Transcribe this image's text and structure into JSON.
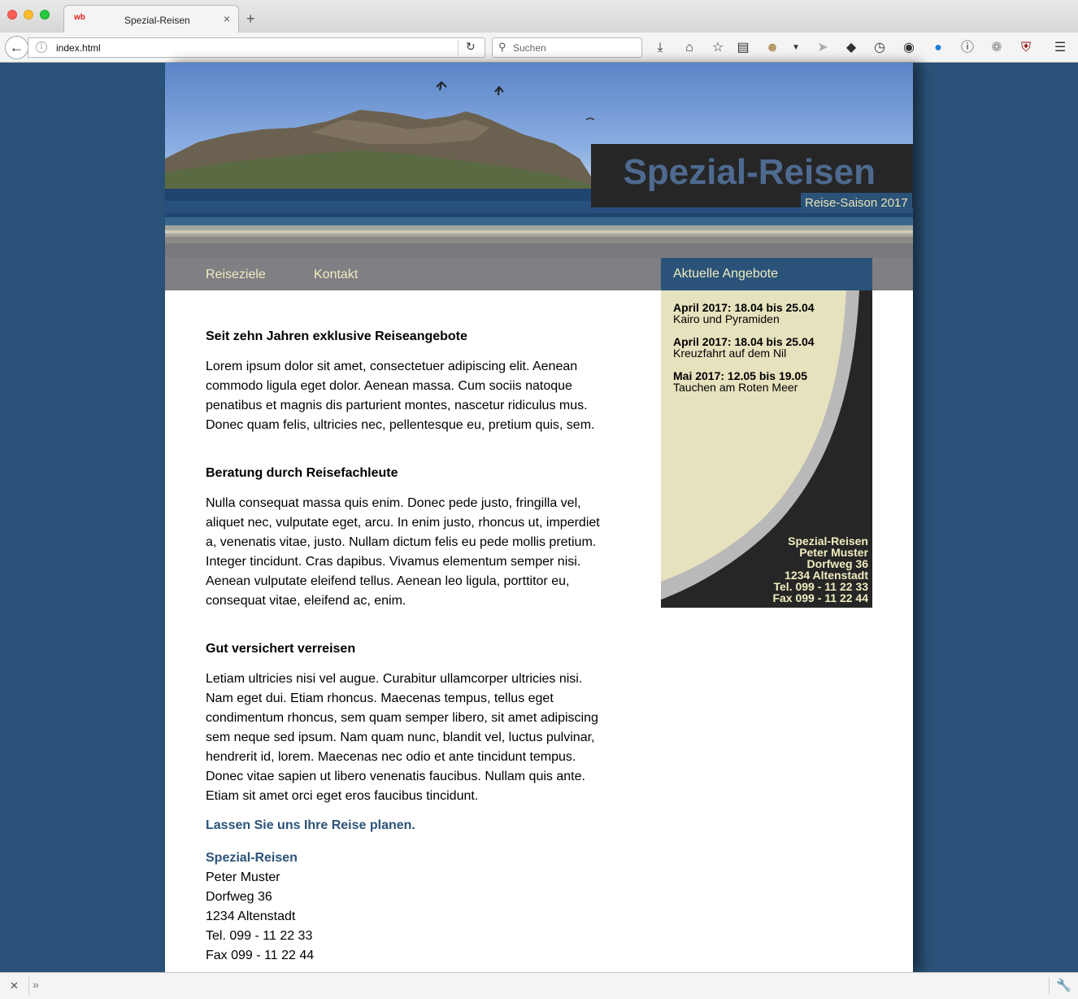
{
  "browser": {
    "tab_title": "Spezial-Reisen",
    "favicon_text": "wb",
    "new_tab_glyph": "+",
    "tab_close_glyph": "×",
    "url": "index.html",
    "search_placeholder": "Suchen",
    "toolbar_icons": [
      "download-icon",
      "home-icon",
      "bookmark-star-icon",
      "reading-list-icon",
      "avatar-icon",
      "dropdown-icon",
      "send-icon",
      "pocket-icon",
      "history-icon",
      "globe-icon",
      "account-icon",
      "info-icon",
      "extension-icon",
      "ublock-icon",
      "menu-icon"
    ]
  },
  "header": {
    "site_title": "Spezial-Reisen",
    "season": "Reise-Saison 2017"
  },
  "nav": {
    "items": [
      {
        "label": "Reiseziele"
      },
      {
        "label": "Kontakt"
      }
    ]
  },
  "main": {
    "sections": [
      {
        "title": "Seit zehn Jahren exklusive Reiseangebote",
        "text": "Lorem ipsum dolor sit amet, consectetuer adipiscing elit. Aenean commodo ligula eget dolor. Aenean massa. Cum sociis natoque penatibus et magnis dis parturient montes, nascetur ridiculus mus. Donec quam felis, ultricies nec, pellentesque eu, pretium quis, sem."
      },
      {
        "title": "Beratung durch Reisefachleute",
        "text": "Nulla consequat massa quis enim. Donec pede justo, fringilla vel, aliquet nec, vulputate eget, arcu. In enim justo, rhoncus ut, imperdiet a, venenatis vitae, justo. Nullam dictum felis eu pede mollis pretium. Integer tincidunt. Cras dapibus. Vivamus elementum semper nisi. Aenean vulputate eleifend tellus. Aenean leo ligula, porttitor eu, consequat vitae, eleifend ac, enim."
      },
      {
        "title": "Gut versichert verreisen",
        "text": "Letiam ultricies nisi vel augue. Curabitur ullamcorper ultricies nisi. Nam eget dui. Etiam rhoncus. Maecenas tempus, tellus eget condimentum rhoncus, sem quam semper libero, sit amet adipiscing sem neque sed ipsum. Nam quam nunc, blandit vel, luctus pulvinar, hendrerit id, lorem. Maecenas nec odio et ante tincidunt tempus. Donec vitae sapien ut libero venenatis faucibus. Nullam quis ante. Etiam sit amet orci eget eros faucibus tincidunt."
      }
    ],
    "cta": "Lassen Sie uns Ihre Reise planen.",
    "address": {
      "company": "Spezial-Reisen",
      "name": "Peter Muster",
      "street": "Dorfweg 36",
      "city": "1234 Altenstadt",
      "phone": "Tel. 099 - 11 22 33",
      "fax": "Fax 099 - 11 22 44"
    }
  },
  "sidebar": {
    "title": "Aktuelle Angebote",
    "offers": [
      {
        "date": "April 2017: 18.04 bis 25.04",
        "desc": "Kairo und Pyramiden"
      },
      {
        "date": "April 2017: 18.04 bis 25.04",
        "desc": "Kreuzfahrt auf dem Nil"
      },
      {
        "date": "Mai 2017: 12.05 bis 19.05",
        "desc": "Tauchen am Roten Meer"
      }
    ],
    "address": {
      "company": "Spezial-Reisen",
      "name": "Peter Muster",
      "street": "Dorfweg 36",
      "city": "1234 Altenstadt",
      "phone": "Tel. 099 - 11 22 33",
      "fax": "Fax 099 - 11 22 44"
    }
  },
  "colors": {
    "background": "#2b5379",
    "accent_blue": "#2b5379",
    "title_blue": "#4e6a90",
    "nav_gray": "#807f84",
    "cream": "#e8e3bd",
    "dark": "#262626"
  }
}
